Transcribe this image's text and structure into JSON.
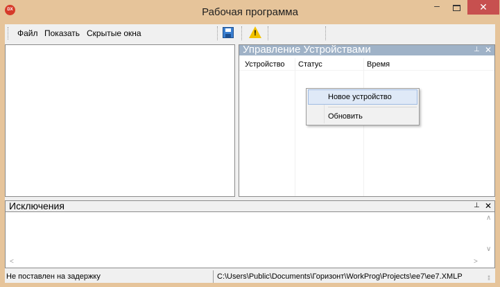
{
  "window": {
    "title": "Рабочая программа",
    "icon_label": "DX",
    "minimize_glyph": "‒",
    "close_glyph": "✕"
  },
  "menu": {
    "items": [
      {
        "label": "Файл"
      },
      {
        "label": "Показать"
      },
      {
        "label": "Скрытые окна"
      }
    ]
  },
  "toolbar": {
    "icons": [
      "save-icon",
      "warning-icon"
    ],
    "warning_glyph": "!"
  },
  "device_panel": {
    "title": "Управление Устройствами",
    "pin_glyph": "⊥",
    "close_glyph": "✕",
    "columns": [
      {
        "label": "Устройство"
      },
      {
        "label": "Статус"
      },
      {
        "label": "Время"
      }
    ]
  },
  "context_menu": {
    "items": [
      {
        "label": "Новое устройство"
      },
      {
        "label": "Обновить"
      }
    ]
  },
  "exceptions_panel": {
    "title": "Исключения",
    "pin_glyph": "⊥",
    "close_glyph": "✕"
  },
  "scroll": {
    "up": "∧",
    "down": "∨",
    "left": "<",
    "right": ">"
  },
  "status_bar": {
    "left_text": "Не поставлен на задержку",
    "path": "C:\\Users\\Public\\Documents\\Горизонт\\WorkProg\\Projects\\ee7\\ee7.XMLP",
    "grip": "⁞⁞"
  },
  "colors": {
    "window_frame": "#e6c49a",
    "close_button": "#c7504f",
    "panel_header": "#9fb2c7",
    "menu_highlight": "#dfe9f7"
  }
}
